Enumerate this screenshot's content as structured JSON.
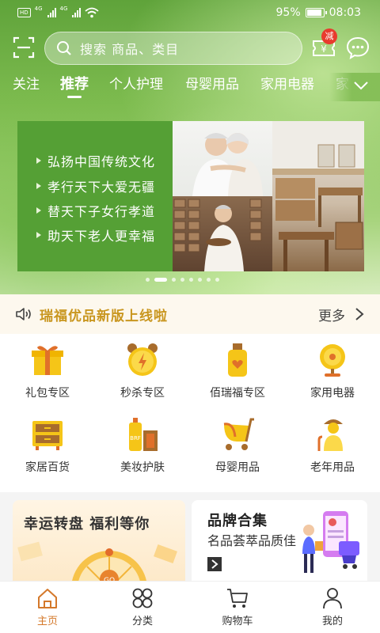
{
  "status_bar": {
    "hd": "HD",
    "sim1_net": "4G",
    "sim2_net": "4G",
    "battery": "95%",
    "time": "08:03"
  },
  "header": {
    "search_placeholder": "搜索 商品、类目",
    "coupon_badge": "减",
    "coupon_symbol": "¥",
    "icons": [
      "scan-icon",
      "search-icon",
      "coupon-icon",
      "message-icon"
    ]
  },
  "category_tabs": [
    {
      "label": "关注",
      "active": false
    },
    {
      "label": "推荐",
      "active": true
    },
    {
      "label": "个人护理",
      "active": false
    },
    {
      "label": "母婴用品",
      "active": false
    },
    {
      "label": "家用电器",
      "active": false
    },
    {
      "label": "家",
      "active": false
    }
  ],
  "banner": {
    "slogans": [
      "弘扬中国传统文化",
      "孝行天下大爱无疆",
      "替天下子女行孝道",
      "助天下老人更幸福"
    ],
    "slide_count": 8,
    "active_slide": 1
  },
  "notice": {
    "text": "瑞福优品新版上线啦",
    "more": "更多"
  },
  "grid": [
    {
      "label": "礼包专区",
      "icon": "gift-icon"
    },
    {
      "label": "秒杀专区",
      "icon": "alarm-clock-icon"
    },
    {
      "label": "佰瑞福专区",
      "icon": "bottle-icon"
    },
    {
      "label": "家用电器",
      "icon": "fan-icon"
    },
    {
      "label": "家居百货",
      "icon": "cabinet-icon"
    },
    {
      "label": "美妆护肤",
      "icon": "cosmetics-icon"
    },
    {
      "label": "母婴用品",
      "icon": "stroller-icon"
    },
    {
      "label": "老年用品",
      "icon": "elder-icon"
    }
  ],
  "promos": {
    "left_title": "幸运转盘 福利等你",
    "wheel_center": "GO",
    "right_title": "品牌合集",
    "right_subtitle": "名品荟萃品质佳"
  },
  "bottom_nav": [
    {
      "label": "主页",
      "icon": "home-icon",
      "active": true
    },
    {
      "label": "分类",
      "icon": "category-icon",
      "active": false
    },
    {
      "label": "购物车",
      "icon": "cart-icon",
      "active": false
    },
    {
      "label": "我的",
      "icon": "profile-icon",
      "active": false
    }
  ],
  "colors": {
    "brand_green": "#55a035",
    "accent_orange": "#d4782a",
    "notice_gold": "#c9961f",
    "icon_yellow": "#f5c518",
    "badge_red": "#e83b2e"
  }
}
